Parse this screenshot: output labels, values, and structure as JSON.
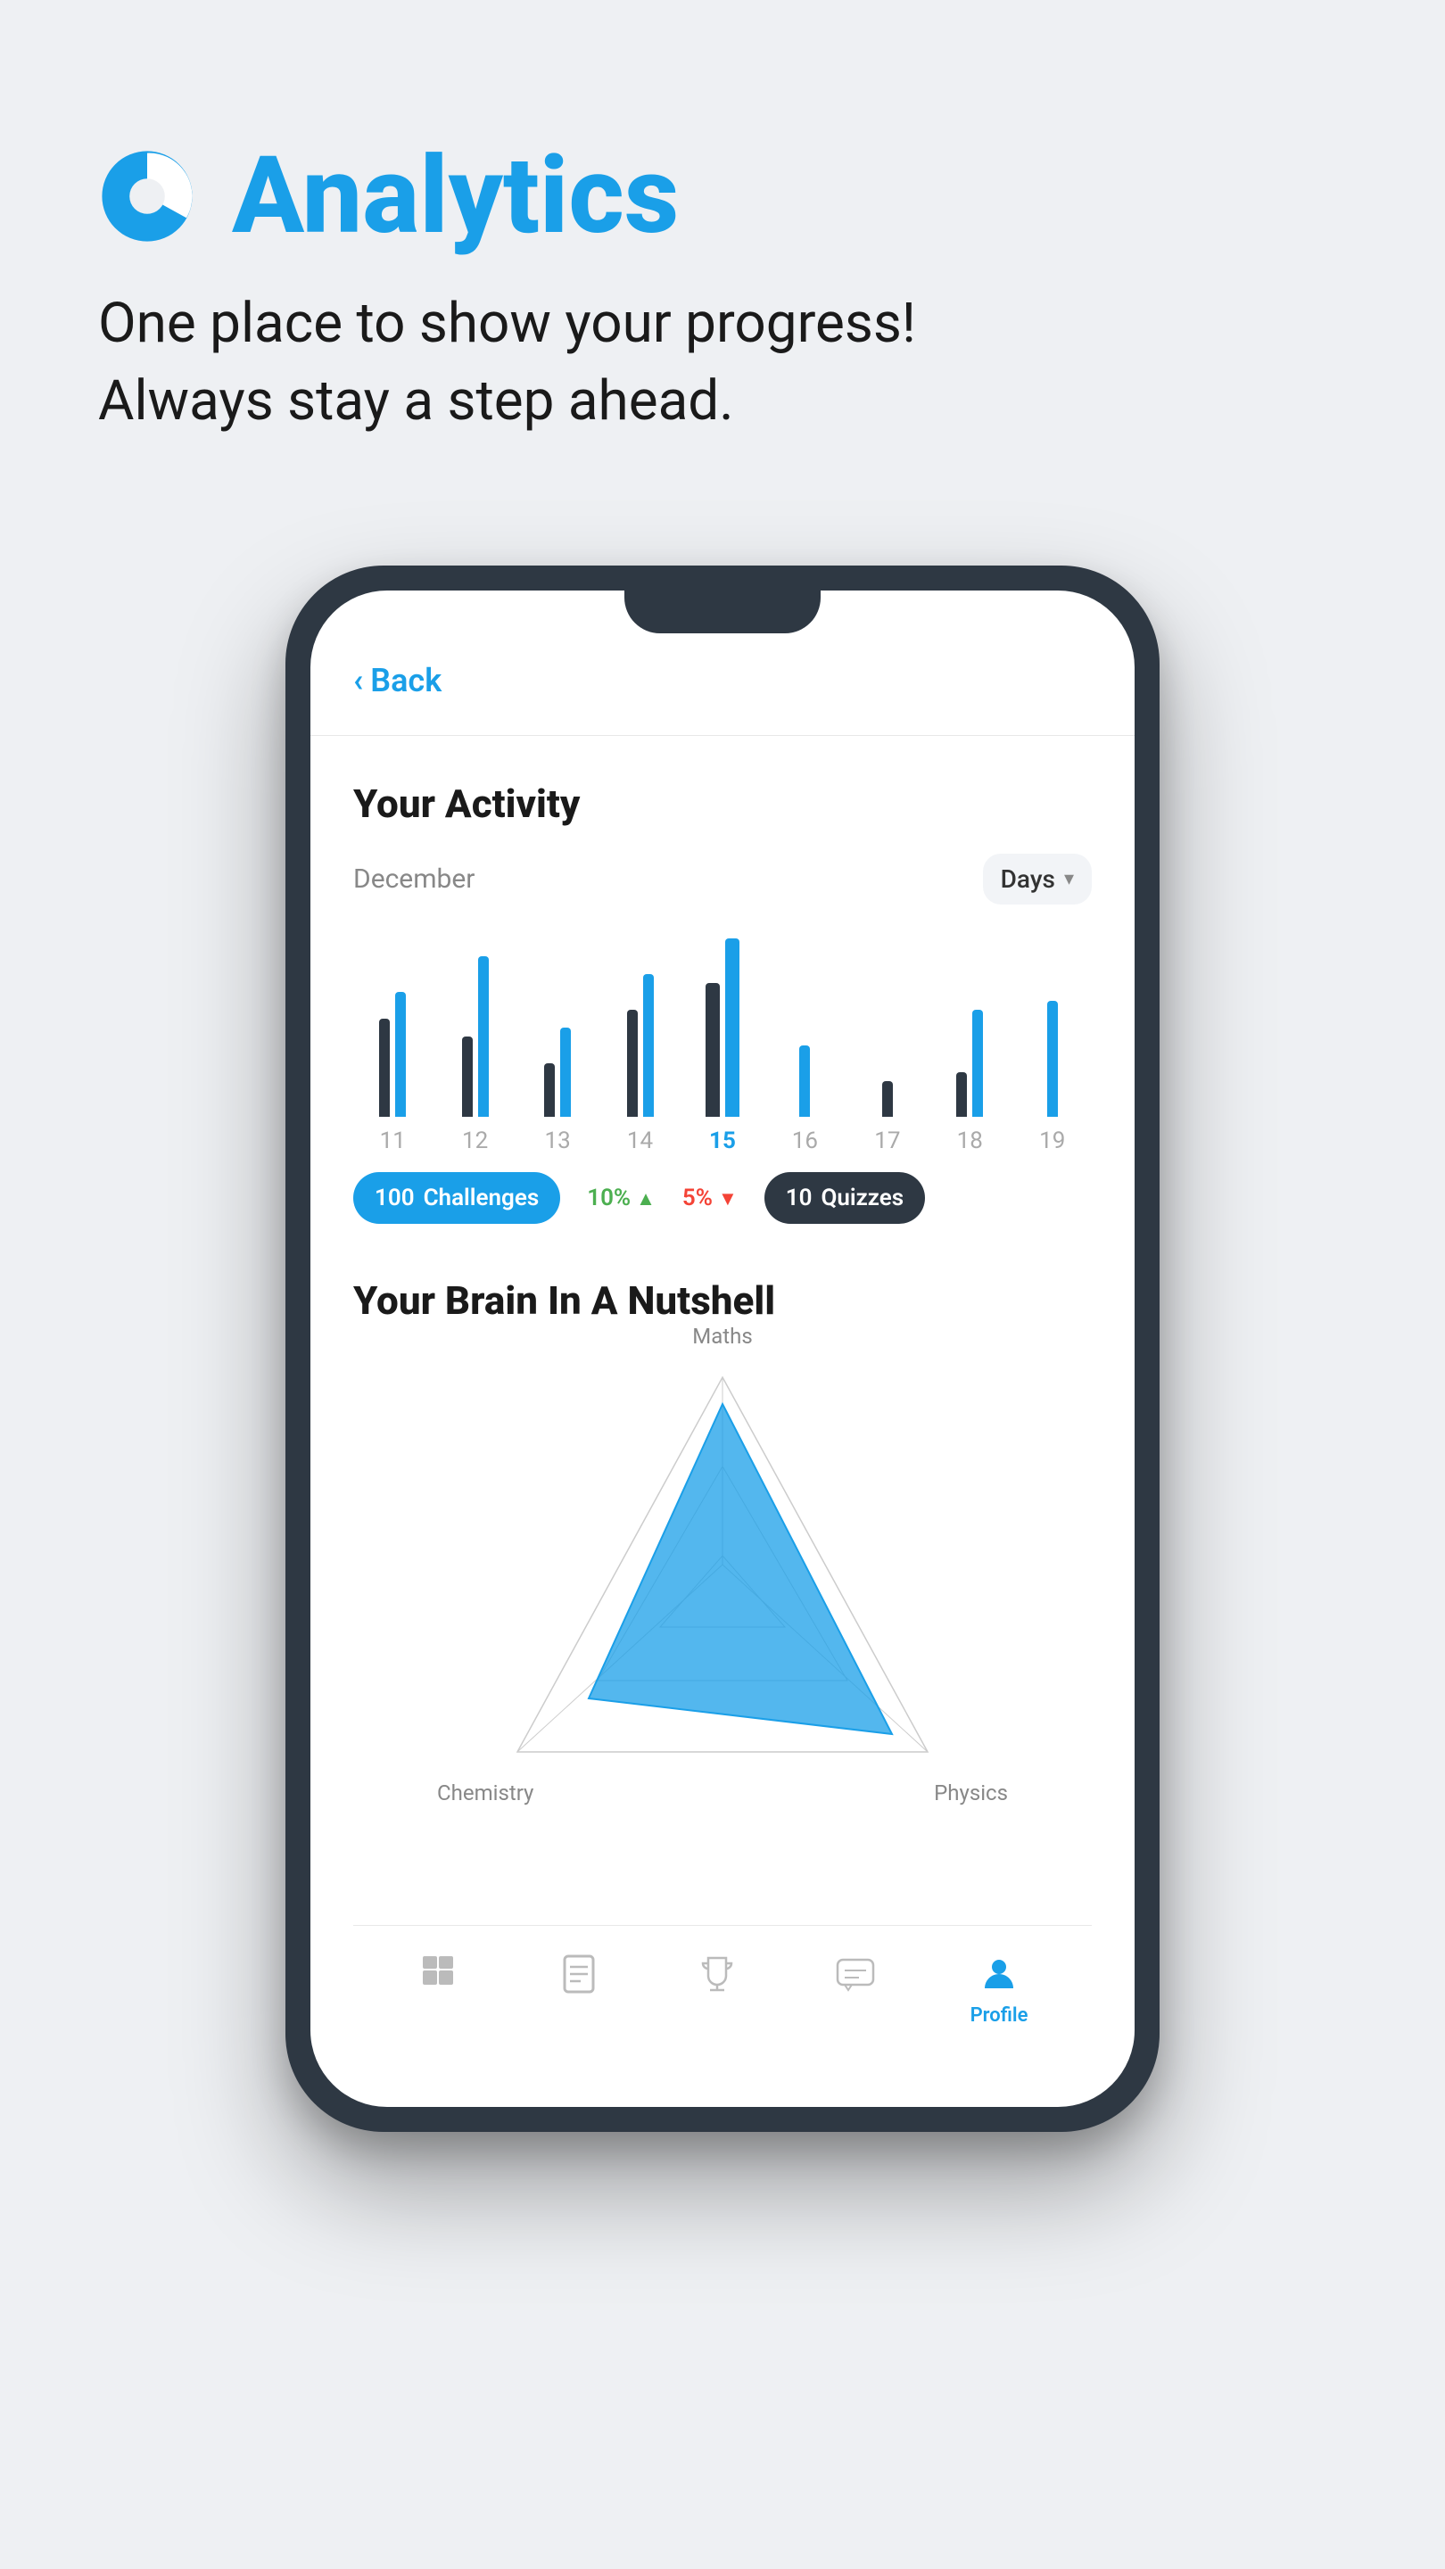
{
  "page": {
    "background": "#eef0f3"
  },
  "header": {
    "icon_alt": "analytics-pie-chart",
    "title": "Analytics",
    "subtitle_line1": "One place to show your progress!",
    "subtitle_line2": "Always stay a step ahead."
  },
  "phone": {
    "back_label": "Back",
    "sections": {
      "activity": {
        "title": "Your Activity",
        "month": "December",
        "filter": "Days",
        "days": [
          "11",
          "12",
          "13",
          "14",
          "15",
          "16",
          "17",
          "18",
          "19"
        ],
        "active_day": "15"
      },
      "stats": {
        "challenges_count": "100",
        "challenges_label": "Challenges",
        "percent1": "10%",
        "percent2": "5%",
        "quizzes_count": "10",
        "quizzes_label": "Quizzes"
      },
      "brain": {
        "title": "Your Brain In A Nutshell",
        "label_maths": "Maths",
        "label_chemistry": "Chemistry",
        "label_physics": "Physics"
      }
    },
    "nav": {
      "items": [
        {
          "id": "home",
          "label": "",
          "active": false
        },
        {
          "id": "book",
          "label": "",
          "active": false
        },
        {
          "id": "trophy",
          "label": "",
          "active": false
        },
        {
          "id": "chat",
          "label": "",
          "active": false
        },
        {
          "id": "profile",
          "label": "Profile",
          "active": true
        }
      ]
    }
  }
}
